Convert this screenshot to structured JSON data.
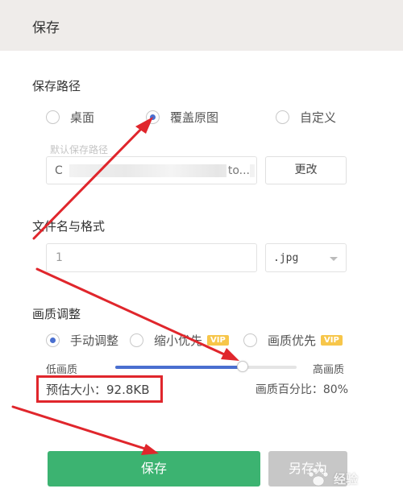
{
  "window": {
    "title": "保存"
  },
  "save_path": {
    "title": "保存路径",
    "options": [
      {
        "label": "桌面",
        "checked": false
      },
      {
        "label": "覆盖原图",
        "checked": true
      },
      {
        "label": "自定义",
        "checked": false
      }
    ],
    "default_label": "默认保存路径",
    "path_value_start": "C",
    "path_value_end": "to...",
    "change_button": "更改"
  },
  "file_name": {
    "title": "文件名与格式",
    "name_value": "1",
    "format_value": ".jpg"
  },
  "quality": {
    "title": "画质调整",
    "options": [
      {
        "label": "手动调整",
        "checked": true,
        "vip": false
      },
      {
        "label": "缩小优先",
        "checked": false,
        "vip": true
      },
      {
        "label": "画质优先",
        "checked": false,
        "vip": true
      }
    ],
    "vip_badge": "VIP",
    "low_label": "低画质",
    "high_label": "高画质",
    "slider_value_percent": 70,
    "estimated_size": "预估大小：92.8KB",
    "ratio_text": "画质百分比：80%"
  },
  "actions": {
    "save_button": "保存",
    "save_as_button": "另存为"
  },
  "watermark": {
    "text": "经验"
  },
  "colors": {
    "primary_green": "#3cb371",
    "accent_blue": "#4a6fd0",
    "annotation_red": "#e0262c",
    "vip_yellow": "#f7c64a"
  }
}
